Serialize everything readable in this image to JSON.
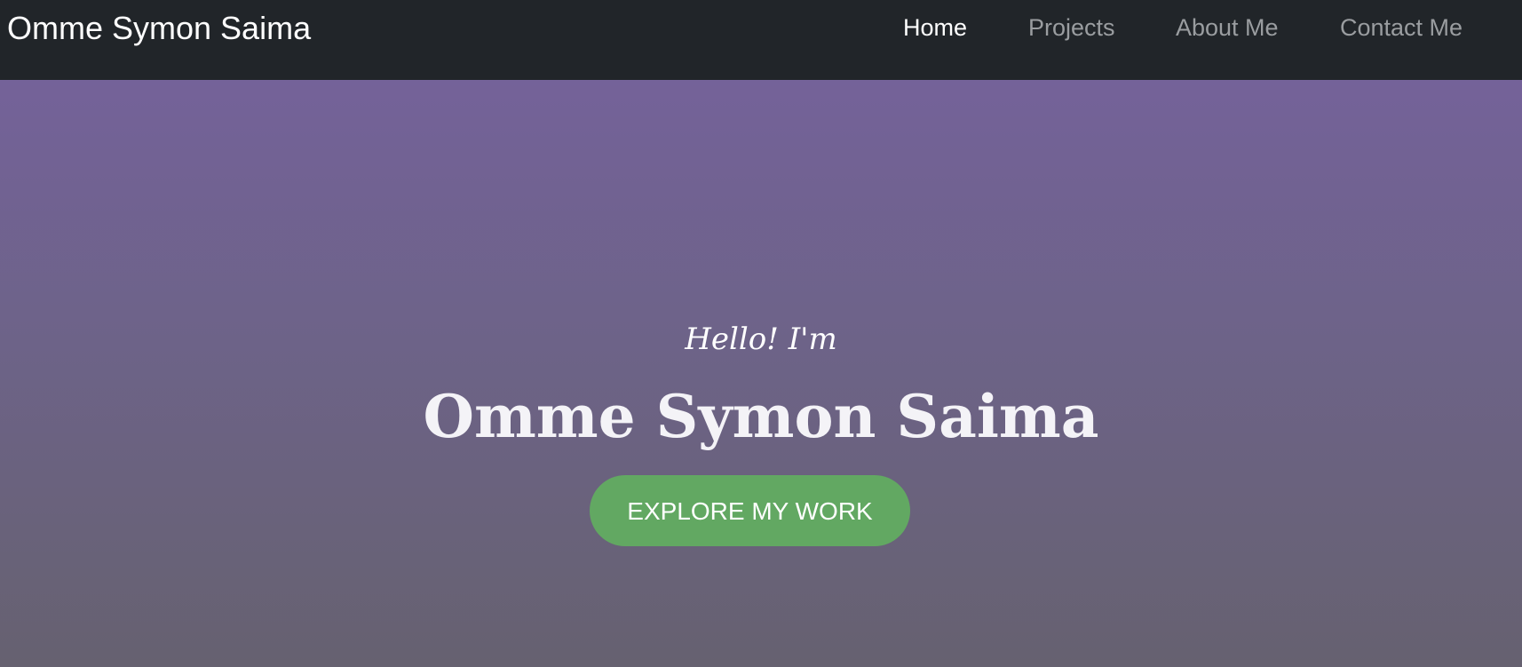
{
  "navbar": {
    "brand": "Omme Symon Saima",
    "links": [
      {
        "label": "Home",
        "active": true
      },
      {
        "label": "Projects",
        "active": false
      },
      {
        "label": "About Me",
        "active": false
      },
      {
        "label": "Contact Me",
        "active": false
      }
    ]
  },
  "hero": {
    "greeting": "Hello! I'm",
    "name": "Omme Symon Saima",
    "cta_label": "EXPLORE MY WORK"
  },
  "colors": {
    "navbar_bg": "#212529",
    "nav_active": "#ffffff",
    "nav_inactive": "#9a9da0",
    "hero_gradient_top": "#746299",
    "hero_gradient_bottom": "#666170",
    "cta_bg": "#62a862"
  }
}
